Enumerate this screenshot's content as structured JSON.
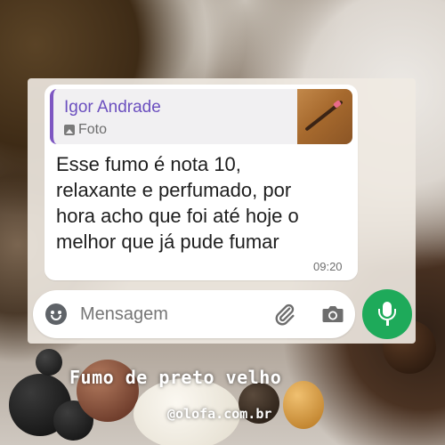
{
  "reply_quote": {
    "sender_name": "Igor Andrade",
    "media_label": "Foto",
    "media_icon": "photo-icon"
  },
  "message": {
    "lines": [
      "Esse fumo é nota 10,",
      "relaxante e perfumado, por",
      "hora acho que foi até hoje o",
      "melhor que já pude fumar"
    ],
    "time": "09:20"
  },
  "composer": {
    "placeholder": "Mensagem",
    "icons": [
      "emoji-icon",
      "attach-icon",
      "camera-icon",
      "mic-icon"
    ]
  },
  "overlay": {
    "caption": "Fumo de preto velho",
    "handle": "@olofa.com.br"
  },
  "colors": {
    "quote_accent": "#7e57c2",
    "sender_name": "#6b4fbf",
    "mic_button": "#1eaa5a"
  }
}
